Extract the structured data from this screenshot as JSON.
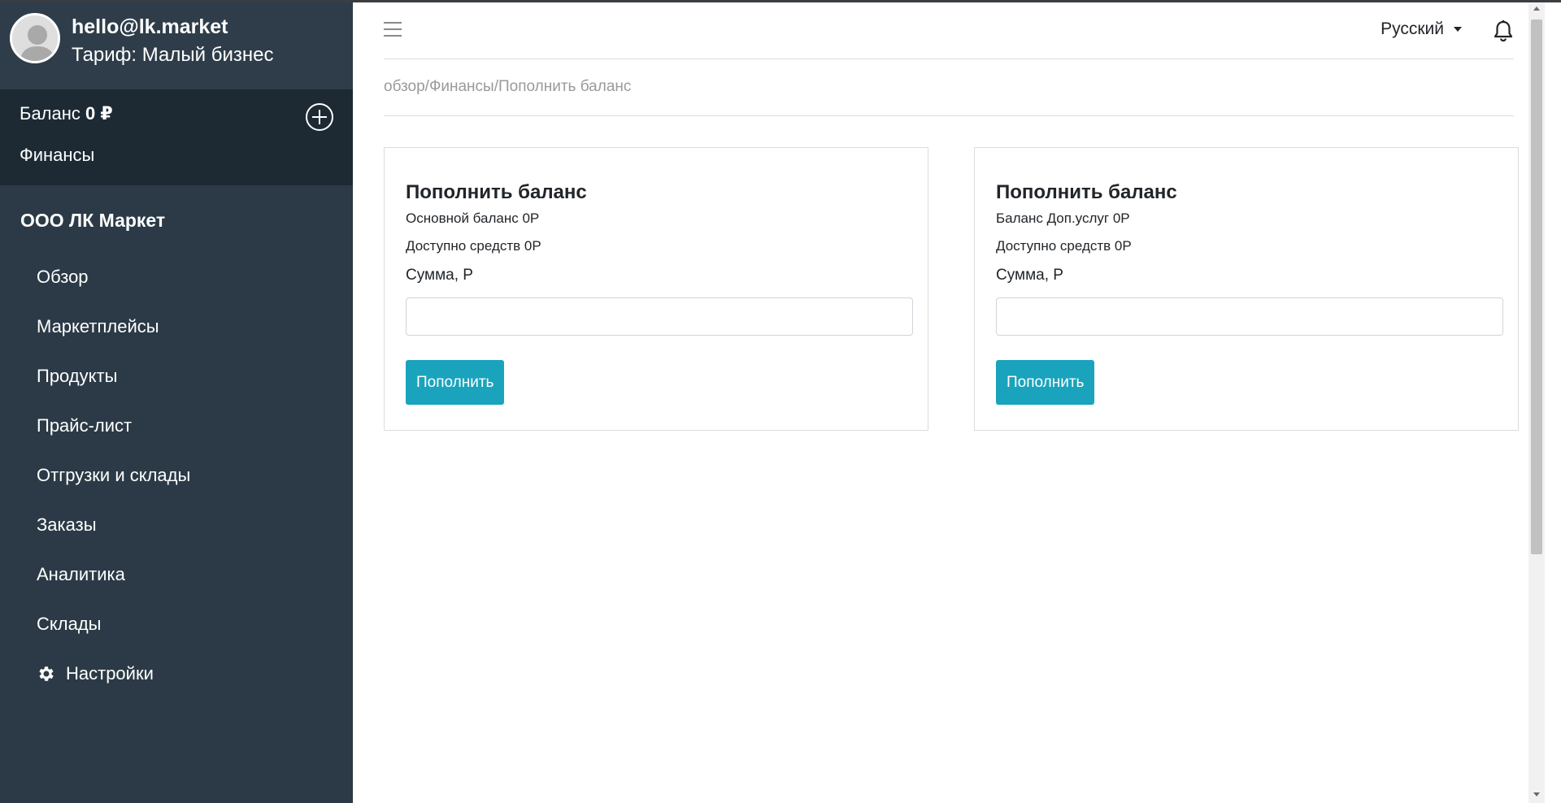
{
  "user": {
    "email": "hello@lk.market",
    "plan": "Тариф: Малый бизнес"
  },
  "balance": {
    "label": "Баланс",
    "amount": "0 ₽",
    "finance_link": "Финансы"
  },
  "company": "ООО ЛК Маркет",
  "nav": {
    "items": [
      {
        "label": "Обзор"
      },
      {
        "label": "Маркетплейсы"
      },
      {
        "label": "Продукты"
      },
      {
        "label": "Прайс-лист"
      },
      {
        "label": "Отгрузки и склады"
      },
      {
        "label": "Заказы"
      },
      {
        "label": "Аналитика"
      },
      {
        "label": "Склады"
      },
      {
        "label": "Настройки",
        "icon": "gear-icon"
      }
    ]
  },
  "topbar": {
    "language": "Русский"
  },
  "breadcrumb": "обзор/Финансы/Пополнить баланс",
  "cards": [
    {
      "title": "Пополнить баланс",
      "line1": "Основной баланс 0Р",
      "line2": "Доступно средств 0Р",
      "amount_label": "Сумма, Р",
      "input_value": "",
      "button": "Пополнить"
    },
    {
      "title": "Пополнить баланс",
      "line1": "Баланс Доп.услуг 0Р",
      "line2": "Доступно средств 0Р",
      "amount_label": "Сумма, Р",
      "input_value": "",
      "button": "Пополнить"
    }
  ],
  "colors": {
    "sidebar": "#2b3a46",
    "sidebar_dark": "#1d2a33",
    "accent_button": "#1aa3bd"
  }
}
